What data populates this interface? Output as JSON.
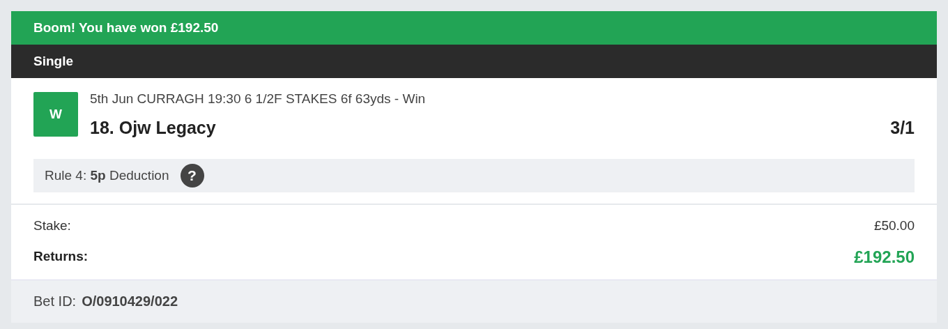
{
  "banner": {
    "text": "Boom! You have won £192.50"
  },
  "bet_type": "Single",
  "selection": {
    "won": true,
    "badge": "W",
    "event": "5th Jun CURRAGH 19:30 6 1/2F STAKES 6f 63yds - Win",
    "runner": "18. Ojw Legacy",
    "odds": "3/1"
  },
  "rule4": {
    "text": "Rule 4: **5p** Deduction",
    "help": "?"
  },
  "stake": {
    "label": "Stake:",
    "value": "£50.00"
  },
  "returns": {
    "label": "Returns:",
    "value": "£192.50"
  },
  "bet_id": {
    "label": "Bet ID:",
    "value": "O/0910429/022"
  }
}
